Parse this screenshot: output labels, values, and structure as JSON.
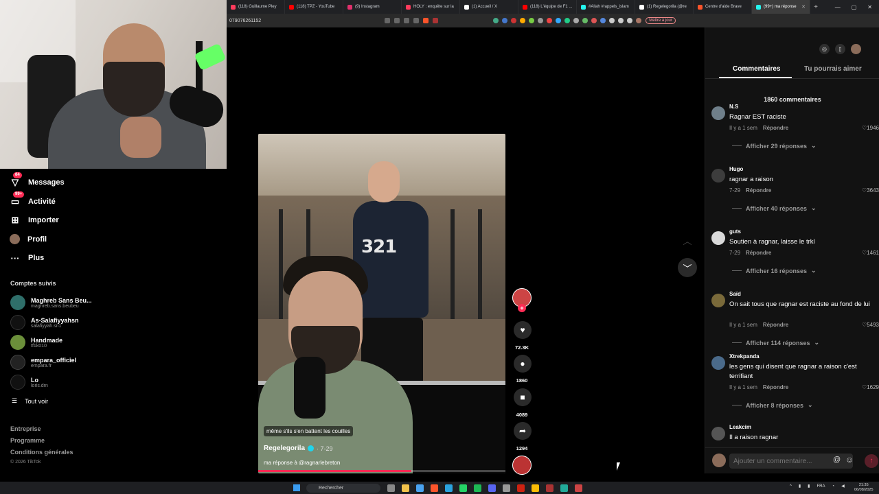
{
  "browser": {
    "tabs": [
      {
        "label": "(118) Guillaume Pley",
        "color": "#ff3b5c"
      },
      {
        "label": "(118) TPZ - YouTube",
        "color": "#ff0000"
      },
      {
        "label": "(9) Instagram",
        "color": "#e1306c"
      },
      {
        "label": "HOLY : enquête sur la",
        "color": "#ff3b5c"
      },
      {
        "label": "(1) Accueil / X",
        "color": "#ffffff"
      },
      {
        "label": "(118) L'équipe de F1 ...",
        "color": "#ff0000"
      },
      {
        "label": "#Allah #rappels_islam",
        "color": "#25f4ee"
      },
      {
        "label": "(1) Regelegorila (@re",
        "color": "#ffffff"
      },
      {
        "label": "Centre d'aide Brave",
        "color": "#fb542b"
      },
      {
        "label": "(99+) ma réponse",
        "color": "#25f4ee",
        "active": true
      }
    ],
    "address_text": "079076261152",
    "update_label": "Mettre à jour"
  },
  "nav": {
    "items": [
      {
        "label": "Messages",
        "badge": "84"
      },
      {
        "label": "Activité",
        "badge": "99+"
      },
      {
        "label": "Importer",
        "badge": ""
      },
      {
        "label": "Profil",
        "badge": ""
      },
      {
        "label": "Plus",
        "badge": ""
      }
    ],
    "following_title": "Comptes suivis",
    "accounts": [
      {
        "name": "Maghreb Sans Beu...",
        "handle": "maghreb.sans.beubeu",
        "color": "#2f6f6a"
      },
      {
        "name": "As-Salafiyyahsn",
        "handle": "salafiyyah.sn1",
        "color": "#111111"
      },
      {
        "name": "Handmade",
        "handle": "tf1k010",
        "color": "#6b8f3a"
      },
      {
        "name": "empara_officiel",
        "handle": "empara.fr",
        "color": "#222222"
      },
      {
        "name": "Lo",
        "handle": "loris.drn",
        "color": "#111111"
      }
    ],
    "see_all": "Tout voir",
    "footer_links": [
      "Entreprise",
      "Programme",
      "Conditions générales"
    ],
    "copyright": "© 2026 TikTok"
  },
  "video": {
    "caption": "même s'ils s'en battent les couilles",
    "author": "Regelegorila",
    "date": "· 7-29",
    "description": "ma réponse à @ragnarlebreton",
    "jersey_number": "321",
    "progress": 0.62
  },
  "actions": {
    "likes": "72.3K",
    "comments": "1860",
    "saves": "4089",
    "shares": "1294"
  },
  "comments_panel": {
    "tab_comments": "Commentaires",
    "tab_suggested": "Tu pourrais aimer",
    "count_label": "1860 commentaires",
    "comments": [
      {
        "user": "N.S",
        "text": "Ragnar EST raciste",
        "time": "Il y a 1 sem",
        "reply": "Répondre",
        "likes": "1946",
        "more": "Afficher 29 réponses",
        "color": "#6f7f8a"
      },
      {
        "user": "Hugo",
        "text": "ragnar a raison",
        "time": "7-29",
        "reply": "Répondre",
        "likes": "3643",
        "more": "Afficher 40 réponses",
        "color": "#3d3d3d"
      },
      {
        "user": "guts",
        "text": "Soutien à ragnar, laisse le trkl",
        "time": "7-29",
        "reply": "Répondre",
        "likes": "1461",
        "more": "Afficher 16 réponses",
        "color": "#d9d9d9"
      },
      {
        "user": "Saïd",
        "text": "On sait tous que ragnar est raciste au fond de lui",
        "time": "Il y a 1 sem",
        "reply": "Répondre",
        "likes": "5493",
        "more": "Afficher 114 réponses",
        "color": "#7a6a3a"
      },
      {
        "user": "Xtrekpanda",
        "text": "les gens qui disent que ragnar a raison c'est terrifiant",
        "time": "Il y a 1 sem",
        "reply": "Répondre",
        "likes": "1629",
        "more": "Afficher 8 réponses",
        "color": "#4a6a8a"
      },
      {
        "user": "Leakcim",
        "text": "Il a raison ragnar",
        "time": "",
        "reply": "",
        "likes": "",
        "more": "",
        "color": "#555555"
      }
    ],
    "input_placeholder": "Ajouter un commentaire..."
  },
  "taskbar": {
    "search_label": "Rechercher",
    "lang": "FRA",
    "time": "21:35",
    "date": "06/08/2025"
  }
}
